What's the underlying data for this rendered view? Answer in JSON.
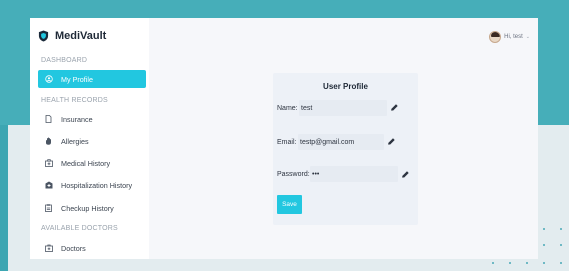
{
  "app": {
    "brand": "MediVault"
  },
  "sidebar": {
    "sections": [
      {
        "label": "DASHBOARD"
      },
      {
        "label": "HEALTH RECORDS"
      },
      {
        "label": "AVAILABLE DOCTORS"
      }
    ],
    "items": [
      {
        "label": "My Profile",
        "icon": "user-circle-icon",
        "active": true
      },
      {
        "label": "Insurance",
        "icon": "document-icon"
      },
      {
        "label": "Allergies",
        "icon": "hand-icon"
      },
      {
        "label": "Medical History",
        "icon": "medical-kit-icon"
      },
      {
        "label": "Hospitalization History",
        "icon": "hospital-icon"
      },
      {
        "label": "Checkup History",
        "icon": "clipboard-icon"
      },
      {
        "label": "Doctors",
        "icon": "medical-bag-icon"
      }
    ]
  },
  "header": {
    "greeting": "Hi, test"
  },
  "profile": {
    "title": "User Profile",
    "name_label": "Name:",
    "name_value": "test",
    "email_label": "Email:",
    "email_value": "testp@gmail.com",
    "password_label": "Password:",
    "password_value": "•••",
    "save_label": "Save"
  },
  "colors": {
    "accent": "#22c7e0",
    "background_top": "#46aeb9",
    "background_bottom": "#e3ecef"
  }
}
